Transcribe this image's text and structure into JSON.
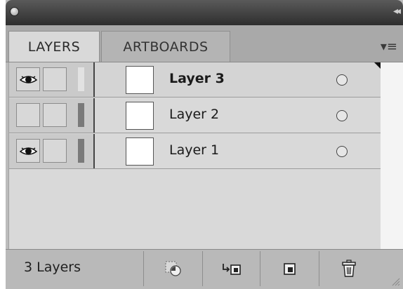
{
  "panel": {
    "tabs": [
      {
        "label": "LAYERS",
        "active": true
      },
      {
        "label": "ARTBOARDS",
        "active": false
      }
    ]
  },
  "layers": [
    {
      "name": "Layer 3",
      "visible": true,
      "selected": true
    },
    {
      "name": "Layer 2",
      "visible": false,
      "selected": false
    },
    {
      "name": "Layer 1",
      "visible": true,
      "selected": false
    }
  ],
  "footer": {
    "layer_count": "3 Layers",
    "buttons": [
      "locate-object-icon",
      "make-clipping-mask-icon",
      "new-layer-icon",
      "delete-icon"
    ]
  },
  "colors": {
    "panel_bg": "#d9d9d9",
    "titlebar": "#3a3a3a"
  }
}
